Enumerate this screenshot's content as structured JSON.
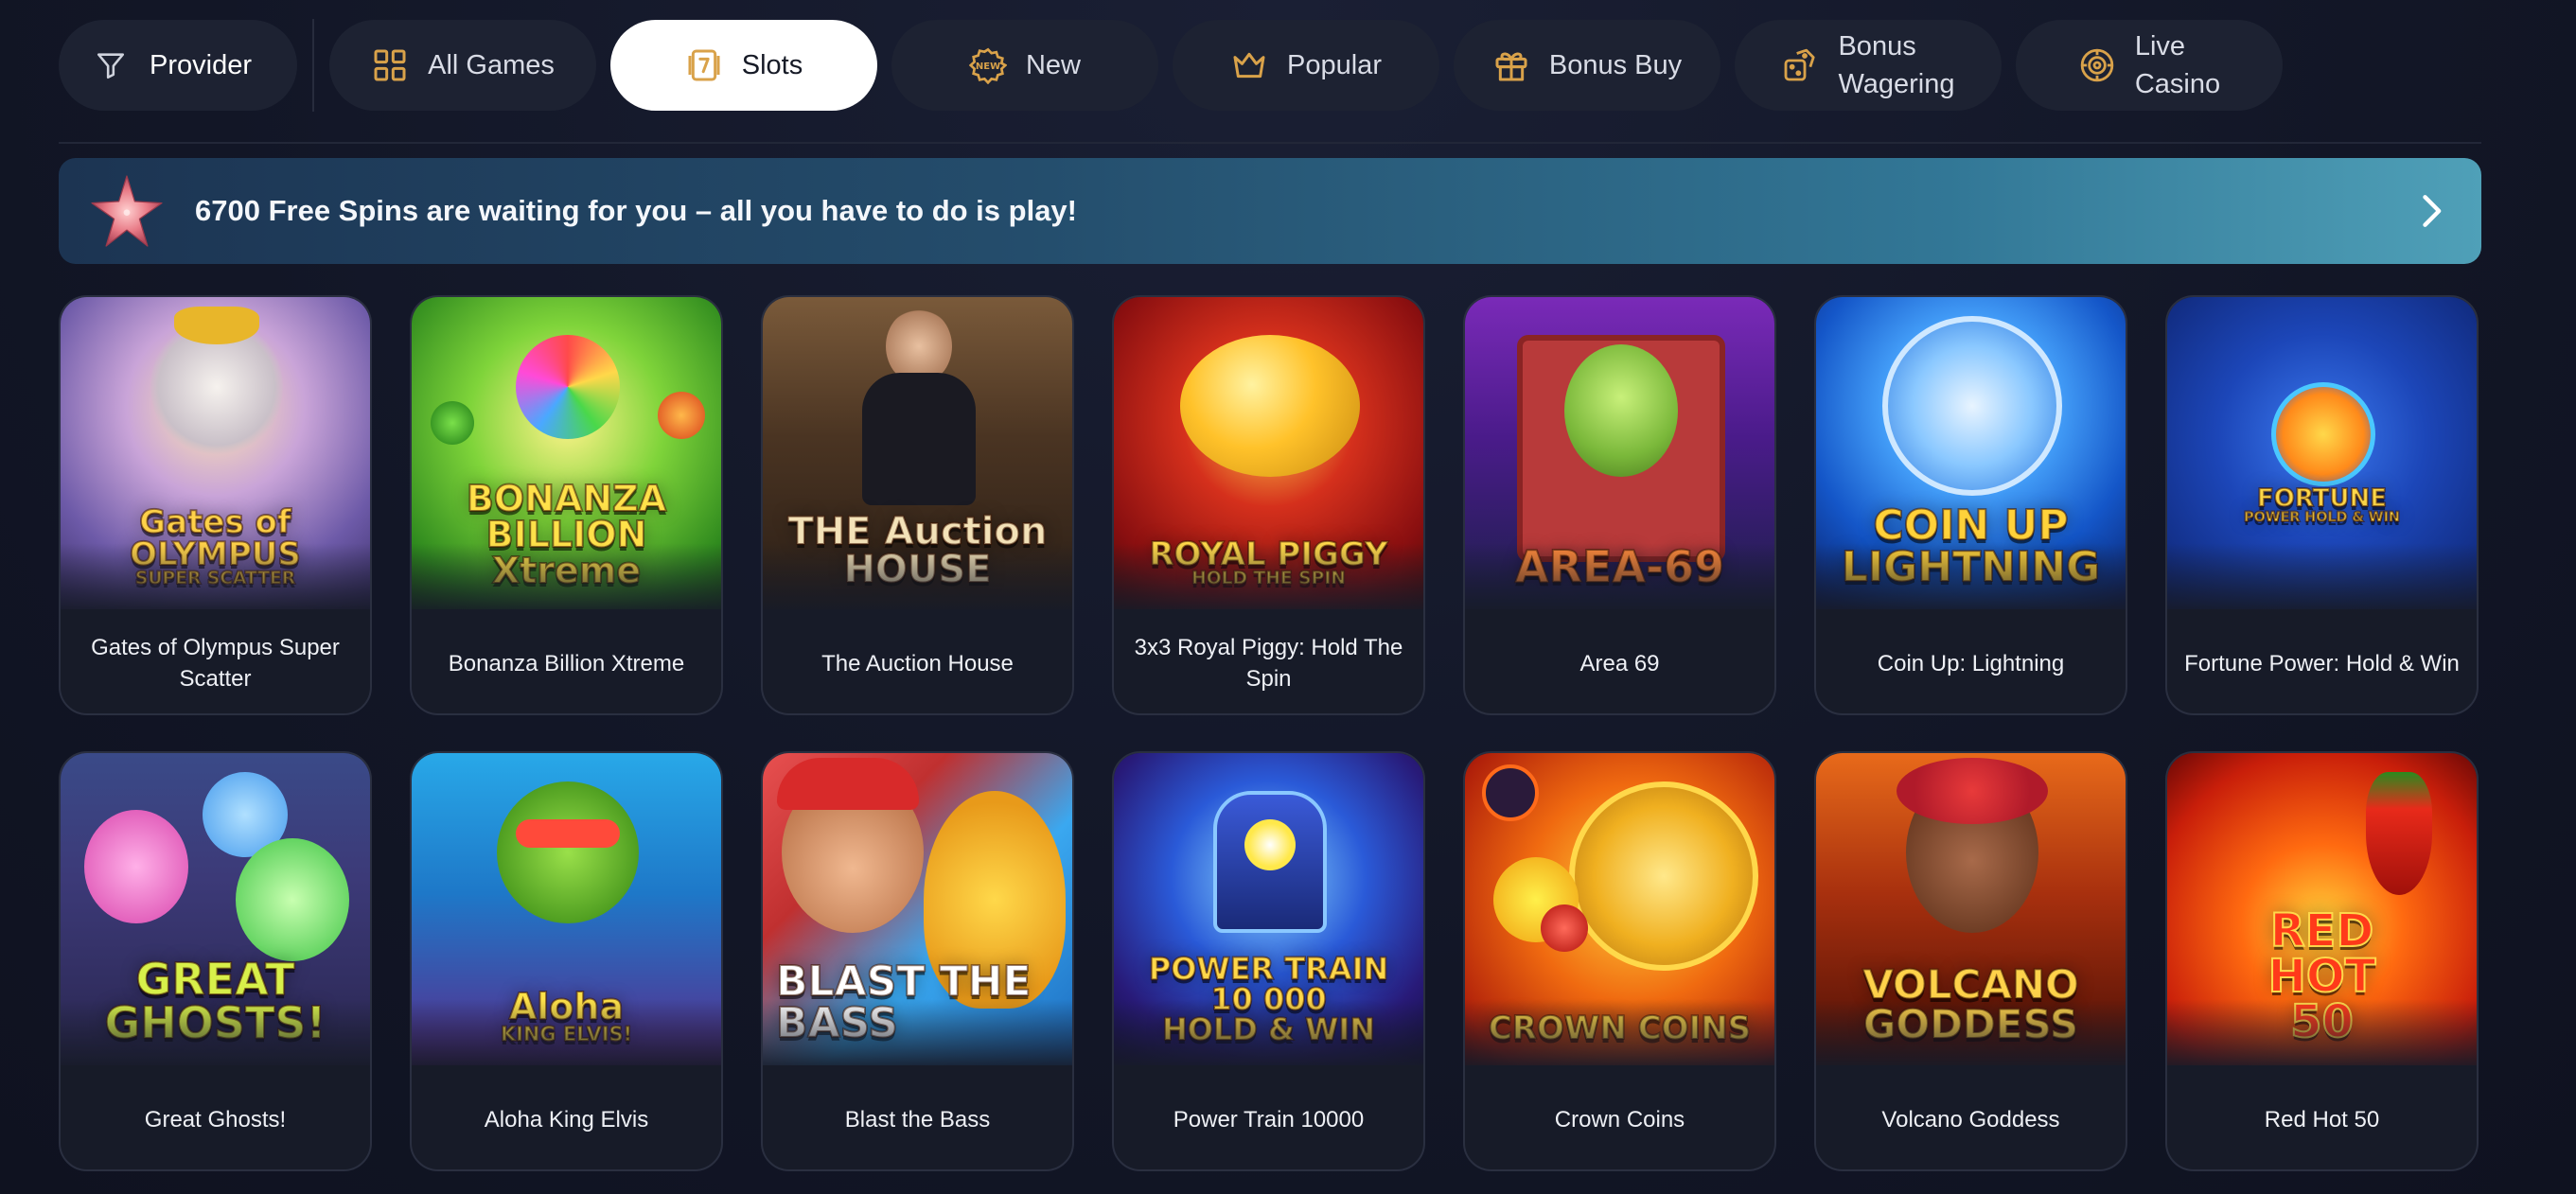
{
  "categories": {
    "provider_label": "Provider",
    "tabs": [
      {
        "label": "All Games",
        "icon": "grid-icon",
        "active": false
      },
      {
        "label": "Slots",
        "icon": "slot-seven-icon",
        "active": true
      },
      {
        "label": "New",
        "icon": "new-badge-icon",
        "active": false
      },
      {
        "label": "Popular",
        "icon": "crown-icon",
        "active": false
      },
      {
        "label": "Bonus Buy",
        "icon": "gift-icon",
        "active": false
      },
      {
        "label": "Bonus\nWagering",
        "icon": "dice-icon",
        "active": false
      },
      {
        "label": "Live\nCasino",
        "icon": "target-chip-icon",
        "active": false
      }
    ]
  },
  "banner": {
    "text": "6700 Free Spins are waiting for you – all you have to do is play!",
    "icon": "starfish-icon",
    "arrow_icon": "chevron-right-icon"
  },
  "games": [
    {
      "title": "Gates of Olympus Super Scatter",
      "art_text": "Gates of\nOLYMPUS\nSUPER SCATTER"
    },
    {
      "title": "Bonanza Billion Xtreme",
      "art_text": "BONANZA\nBILLION\nXtreme"
    },
    {
      "title": "The Auction House",
      "art_text": "THE Auction\nHOUSE"
    },
    {
      "title": "3x3 Royal Piggy: Hold The Spin",
      "art_text": "ROYAL PIGGY\nHOLD THE SPIN"
    },
    {
      "title": "Area 69",
      "art_text": "AREA-69"
    },
    {
      "title": "Coin Up: Lightning",
      "art_text": "COIN UP\nLIGHTNING"
    },
    {
      "title": "Fortune Power: Hold & Win",
      "art_text": "FORTUNE\nPOWER HOLD & WIN"
    },
    {
      "title": "Great Ghosts!",
      "art_text": "GREAT\nGHOSTS!"
    },
    {
      "title": "Aloha King Elvis",
      "art_text": "Aloha\nKING ELVIS!"
    },
    {
      "title": "Blast the Bass",
      "art_text": "BLAST THE\nBASS"
    },
    {
      "title": "Power Train 10000",
      "art_text": "POWER TRAIN\n10 000\nHOLD & WIN"
    },
    {
      "title": "Crown Coins",
      "art_text": "CROWN COINS"
    },
    {
      "title": "Volcano Goddess",
      "art_text": "VOLCANO\nGODDESS"
    },
    {
      "title": "Red Hot 50",
      "art_text": "RED\nHOT\n50"
    }
  ],
  "colors": {
    "background": "#131728",
    "pill": "#1d2232",
    "active_pill": "#ffffff",
    "icon_gold": "#d9a24a",
    "banner_start": "#1c3452",
    "banner_end": "#4fa0b8"
  }
}
